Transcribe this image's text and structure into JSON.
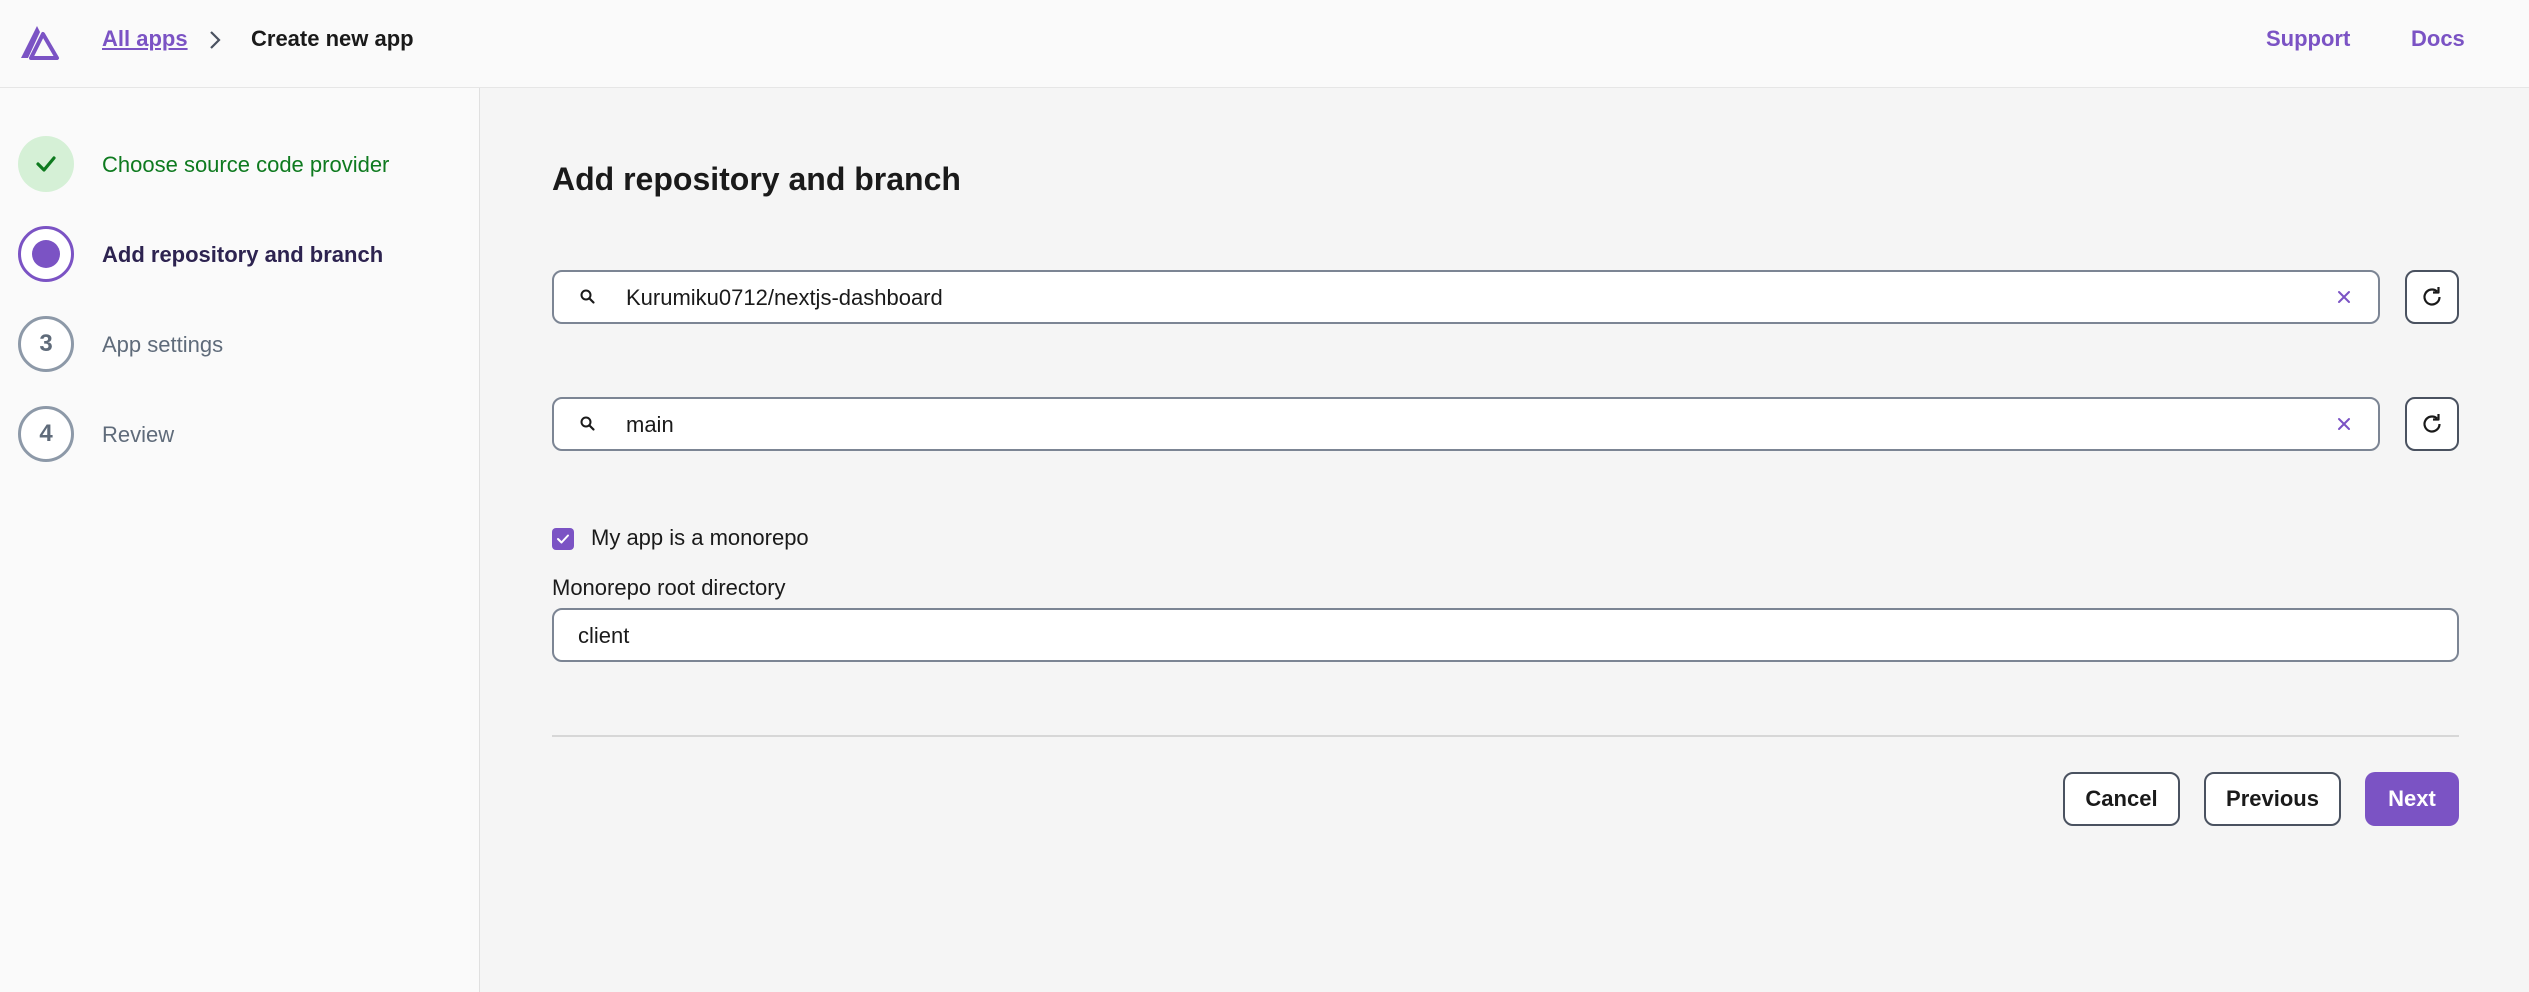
{
  "header": {
    "breadcrumb_link": "All apps",
    "breadcrumb_current": "Create new app",
    "support": "Support",
    "docs": "Docs"
  },
  "steps": [
    {
      "label": "Choose source code provider",
      "state": "done",
      "number": ""
    },
    {
      "label": "Add repository and branch",
      "state": "active",
      "number": ""
    },
    {
      "label": "App settings",
      "state": "todo",
      "number": "3"
    },
    {
      "label": "Review",
      "state": "todo",
      "number": "4"
    }
  ],
  "main": {
    "title": "Add repository and branch",
    "repository_value": "Kurumiku0712/nextjs-dashboard",
    "branch_value": "main",
    "monorepo_checkbox_label": "My app is a monorepo",
    "monorepo_checked": true,
    "root_dir_label": "Monorepo root directory",
    "root_dir_value": "client"
  },
  "buttons": {
    "cancel": "Cancel",
    "previous": "Previous",
    "next": "Next"
  },
  "colors": {
    "accent": "#7b53c4",
    "success": "#0e7a1f",
    "success_bg": "#d5f0d6"
  }
}
